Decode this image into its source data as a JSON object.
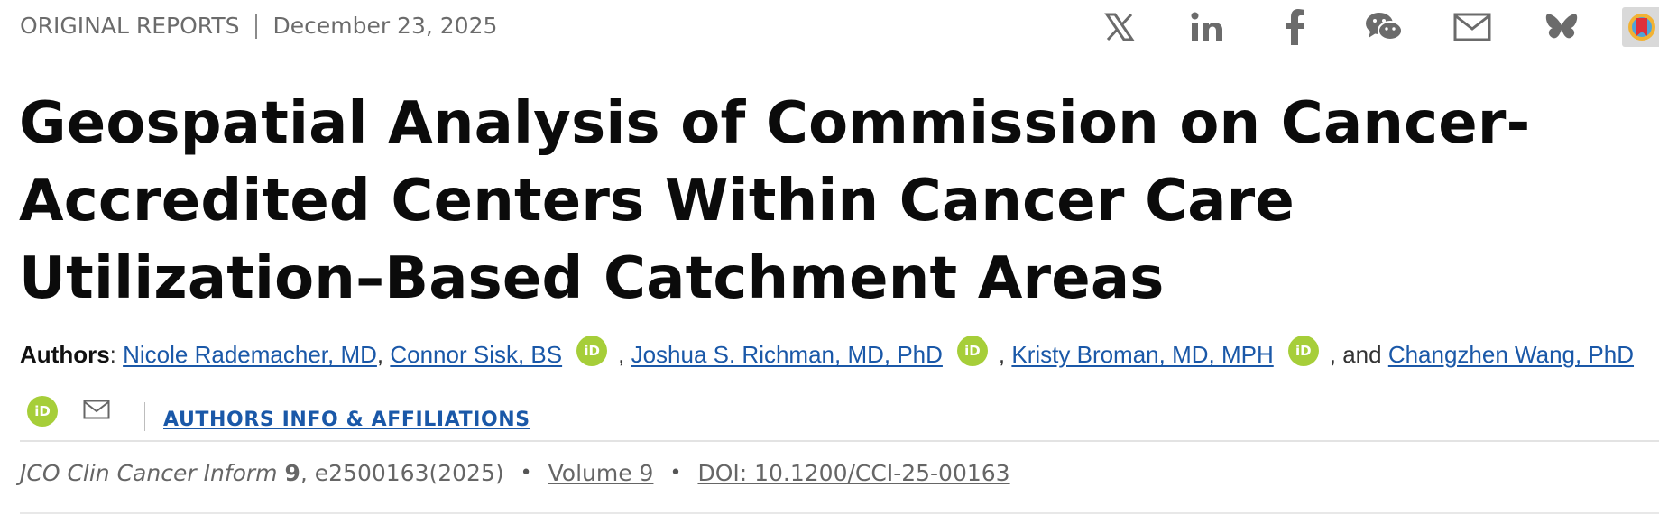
{
  "header": {
    "section_label": "ORIGINAL REPORTS",
    "date": "December 23, 2025"
  },
  "share": {
    "icons": [
      "x-icon",
      "linkedin-icon",
      "facebook-icon",
      "wechat-icon",
      "email-icon",
      "bluesky-icon",
      "mendeley-icon"
    ],
    "colors": {
      "icon": "#6b6b6b"
    }
  },
  "article": {
    "title": "Geospatial Analysis of Commission on Cancer-Accredited Centers Within Cancer Care Utilization–Based Catchment Areas"
  },
  "authors": {
    "label": "Authors",
    "list": [
      {
        "name": "Nicole Rademacher, MD"
      },
      {
        "name": "Connor Sisk, BS"
      },
      {
        "name": "Joshua S. Richman, MD, PhD"
      },
      {
        "name": "Kristy Broman, MD, MPH"
      },
      {
        "name": "Changzhen Wang, PhD"
      }
    ],
    "conjunction": ", and",
    "orcid_label": "iD",
    "affiliations_link": "AUTHORS INFO & AFFILIATIONS"
  },
  "citation": {
    "journal": "JCO Clin Cancer Inform",
    "volume_num": "9",
    "article_id": ", e2500163(2025)",
    "bullet": "•",
    "volume_link": "Volume 9",
    "doi_link": "DOI: 10.1200/CCI-25-00163"
  },
  "colors": {
    "link": "#1a58a8",
    "orcid": "#a6ce39",
    "meta_text": "#6b6b6b"
  }
}
